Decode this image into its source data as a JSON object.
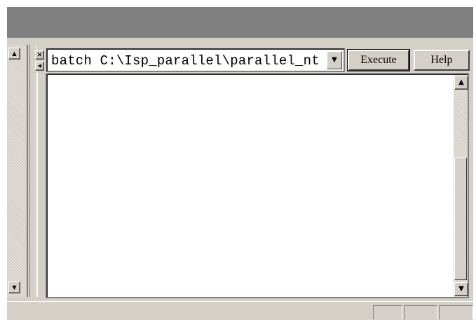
{
  "command": {
    "value": "batch C:\\Isp_parallel\\parallel_nt",
    "execute_label": "Execute",
    "help_label": "Help"
  },
  "icons": {
    "close": "close-icon",
    "left_arrow": "arrow-left-icon",
    "dropdown": "chevron-down-icon",
    "scroll_up": "arrow-up-icon",
    "scroll_down": "arrow-down-icon"
  },
  "glyphs": {
    "close": "×",
    "left": "◀",
    "down": "▼",
    "up": "▲"
  },
  "output": {
    "text": ""
  },
  "colors": {
    "titlebar": "#808080",
    "face": "#d4d0c8",
    "window": "#ffffff"
  }
}
